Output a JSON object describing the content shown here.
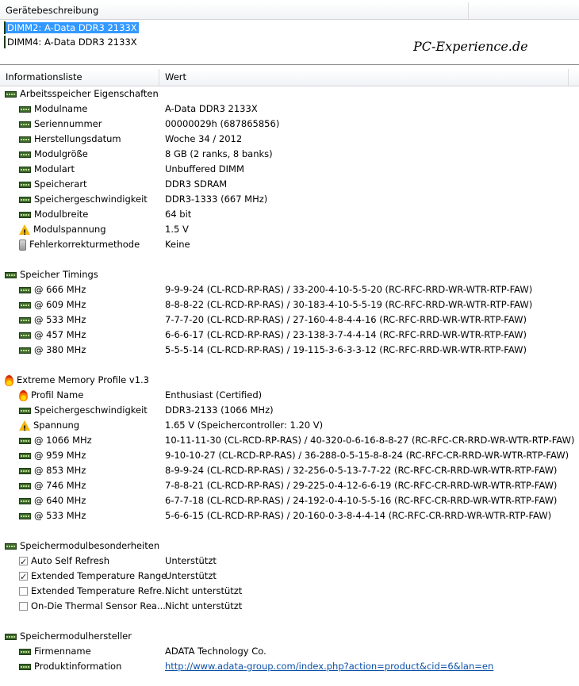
{
  "top_header": {
    "title": "Gerätebeschreibung"
  },
  "devices": [
    {
      "label": "DIMM2: A-Data DDR3 2133X",
      "selected": true
    },
    {
      "label": "DIMM4: A-Data DDR3 2133X",
      "selected": false
    }
  ],
  "watermark": "PC-Experience.de",
  "info_header": {
    "col1": "Informationsliste",
    "col2": "Wert"
  },
  "sections": [
    {
      "title": "Arbeitsspeicher Eigenschaften",
      "icon": "ram-icon",
      "rows": [
        {
          "name": "Modulname",
          "value": "A-Data DDR3 2133X",
          "icon": "ram-icon"
        },
        {
          "name": "Seriennummer",
          "value": "00000029h (687865856)",
          "icon": "ram-icon"
        },
        {
          "name": "Herstellungsdatum",
          "value": "Woche 34 / 2012",
          "icon": "ram-icon"
        },
        {
          "name": "Modulgröße",
          "value": "8 GB (2 ranks, 8 banks)",
          "icon": "ram-icon"
        },
        {
          "name": "Modulart",
          "value": "Unbuffered DIMM",
          "icon": "ram-icon"
        },
        {
          "name": "Speicherart",
          "value": "DDR3 SDRAM",
          "icon": "ram-icon"
        },
        {
          "name": "Speichergeschwindigkeit",
          "value": "DDR3-1333 (667 MHz)",
          "icon": "ram-icon"
        },
        {
          "name": "Modulbreite",
          "value": "64 bit",
          "icon": "ram-icon"
        },
        {
          "name": "Modulspannung",
          "value": "1.5 V",
          "icon": "warning-icon"
        },
        {
          "name": "Fehlerkorrekturmethode",
          "value": "Keine",
          "icon": "ecc-icon"
        }
      ]
    },
    {
      "title": "Speicher Timings",
      "icon": "ram-icon",
      "rows": [
        {
          "name": "@ 666 MHz",
          "value": "9-9-9-24  (CL-RCD-RP-RAS) / 33-200-4-10-5-5-20  (RC-RFC-RRD-WR-WTR-RTP-FAW)",
          "icon": "ram-icon"
        },
        {
          "name": "@ 609 MHz",
          "value": "8-8-8-22  (CL-RCD-RP-RAS) / 30-183-4-10-5-5-19  (RC-RFC-RRD-WR-WTR-RTP-FAW)",
          "icon": "ram-icon"
        },
        {
          "name": "@ 533 MHz",
          "value": "7-7-7-20  (CL-RCD-RP-RAS) / 27-160-4-8-4-4-16  (RC-RFC-RRD-WR-WTR-RTP-FAW)",
          "icon": "ram-icon"
        },
        {
          "name": "@ 457 MHz",
          "value": "6-6-6-17  (CL-RCD-RP-RAS) / 23-138-3-7-4-4-14  (RC-RFC-RRD-WR-WTR-RTP-FAW)",
          "icon": "ram-icon"
        },
        {
          "name": "@ 380 MHz",
          "value": "5-5-5-14  (CL-RCD-RP-RAS) / 19-115-3-6-3-3-12  (RC-RFC-RRD-WR-WTR-RTP-FAW)",
          "icon": "ram-icon"
        }
      ]
    },
    {
      "title": "Extreme Memory Profile v1.3",
      "icon": "fire-icon",
      "rows": [
        {
          "name": "Profil Name",
          "value": "Enthusiast (Certified)",
          "icon": "fire-icon"
        },
        {
          "name": "Speichergeschwindigkeit",
          "value": "DDR3-2133 (1066 MHz)",
          "icon": "ram-icon"
        },
        {
          "name": "Spannung",
          "value": "1.65 V  (Speichercontroller: 1.20 V)",
          "icon": "warning-icon"
        },
        {
          "name": "@ 1066 MHz",
          "value": "10-11-11-30  (CL-RCD-RP-RAS) / 40-320-0-6-16-8-8-27  (RC-RFC-CR-RRD-WR-WTR-RTP-FAW)",
          "icon": "ram-icon"
        },
        {
          "name": "@ 959 MHz",
          "value": "9-10-10-27  (CL-RCD-RP-RAS) / 36-288-0-5-15-8-8-24  (RC-RFC-CR-RRD-WR-WTR-RTP-FAW)",
          "icon": "ram-icon"
        },
        {
          "name": "@ 853 MHz",
          "value": "8-9-9-24  (CL-RCD-RP-RAS) / 32-256-0-5-13-7-7-22  (RC-RFC-CR-RRD-WR-WTR-RTP-FAW)",
          "icon": "ram-icon"
        },
        {
          "name": "@ 746 MHz",
          "value": "7-8-8-21  (CL-RCD-RP-RAS) / 29-225-0-4-12-6-6-19  (RC-RFC-CR-RRD-WR-WTR-RTP-FAW)",
          "icon": "ram-icon"
        },
        {
          "name": "@ 640 MHz",
          "value": "6-7-7-18  (CL-RCD-RP-RAS) / 24-192-0-4-10-5-5-16  (RC-RFC-CR-RRD-WR-WTR-RTP-FAW)",
          "icon": "ram-icon"
        },
        {
          "name": "@ 533 MHz",
          "value": "5-6-6-15  (CL-RCD-RP-RAS) / 20-160-0-3-8-4-4-14  (RC-RFC-CR-RRD-WR-WTR-RTP-FAW)",
          "icon": "ram-icon"
        }
      ]
    },
    {
      "title": "Speichermodulbesonderheiten",
      "icon": "ram-icon",
      "rows": [
        {
          "name": "Auto Self Refresh",
          "value": "Unterstützt",
          "icon": "checkbox-checked-icon"
        },
        {
          "name": "Extended Temperature Range",
          "value": "Unterstützt",
          "icon": "checkbox-checked-icon"
        },
        {
          "name": "Extended Temperature Refre...",
          "value": "Nicht unterstützt",
          "icon": "checkbox-empty-icon"
        },
        {
          "name": "On-Die Thermal Sensor Rea...",
          "value": "Nicht unterstützt",
          "icon": "checkbox-empty-icon"
        }
      ]
    },
    {
      "title": "Speichermodulhersteller",
      "icon": "ram-icon",
      "rows": [
        {
          "name": "Firmenname",
          "value": "ADATA Technology Co.",
          "icon": "ram-icon"
        },
        {
          "name": "Produktinformation",
          "value": "http://www.adata-group.com/index.php?action=product&cid=6&lan=en",
          "icon": "ram-icon",
          "link": true
        }
      ]
    }
  ]
}
